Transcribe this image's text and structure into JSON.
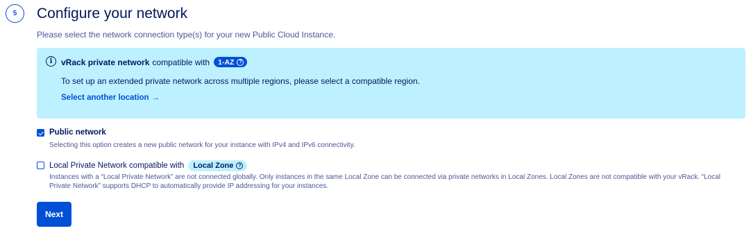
{
  "step": {
    "number": "5",
    "title": "Configure your network",
    "subtitle": "Please select the network connection type(s) for your new Public Cloud Instance."
  },
  "vrack_notice": {
    "icon": "info-icon",
    "title_bold": "vRack private network",
    "title_rest": "compatible with",
    "badge": "1-AZ",
    "badge_help_icon": "question-icon",
    "body": "To set up an extended private network across multiple regions, please select a compatible region.",
    "link_label": "Select another location",
    "link_arrow": "→"
  },
  "options": {
    "public_network": {
      "checked": true,
      "label": "Public network",
      "description": "Selecting this option creates a new public network for your instance with IPv4 and IPv6 connectivity."
    },
    "local_private_network": {
      "checked": false,
      "label": "Local Private Network compatible with",
      "badge": "Local Zone",
      "badge_help_icon": "question-icon",
      "description": "Instances with a “Local Private Network” are not connected globally. Only instances in the same Local Zone can be connected via private networks in Local Zones. Local Zones are not compatible with your vRack. “Local Private Network” supports DHCP to automatically provide IP addressing for your instances."
    }
  },
  "actions": {
    "next_label": "Next"
  },
  "colors": {
    "primary": "#0050d7",
    "heading": "#00185e",
    "info_background": "#bef1ff",
    "muted_text": "#4d5693"
  }
}
